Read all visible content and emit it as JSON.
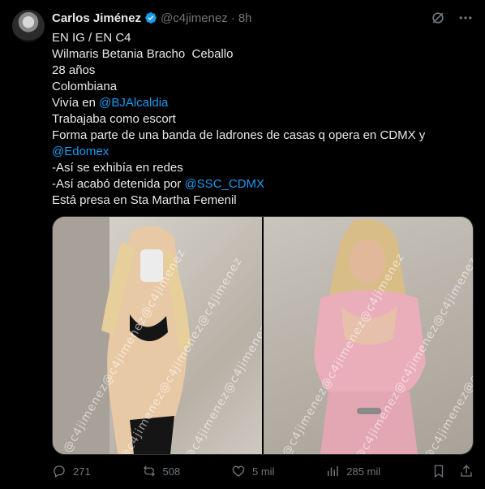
{
  "author": {
    "name": "Carlos Jiménez",
    "handle": "@c4jimenez",
    "separator": "·",
    "time": "8h",
    "verified_color": "#1d9bf0"
  },
  "tweet_lines": [
    {
      "text": "EN IG / EN C4"
    },
    {
      "text": "Wilmaris Betania Bracho  Ceballo"
    },
    {
      "text": "28 años"
    },
    {
      "text": "Colombiana"
    },
    {
      "text": "Vivía en ",
      "mention": "@BJAlcaldia"
    },
    {
      "text": "Trabajaba como escort"
    },
    {
      "text": "Forma parte de una banda de ladrones de casas q opera en CDMX y"
    },
    {
      "text": "",
      "mention": "@Edomex"
    },
    {
      "text": "-Así se exhibía en redes"
    },
    {
      "text": "-Así acabó detenida por ",
      "mention": "@SSC_CDMX"
    },
    {
      "text": "Está presa en Sta Martha Femenil"
    }
  ],
  "media": {
    "watermark": "@c4jimenez@c4jimenez@c4jimenez"
  },
  "actions": {
    "replies": "271",
    "reposts": "508",
    "likes": "5 mil",
    "views": "285 mil"
  },
  "colors": {
    "background": "#000000",
    "text": "#e7e9ea",
    "muted": "#71767b",
    "accent": "#1d9bf0"
  }
}
